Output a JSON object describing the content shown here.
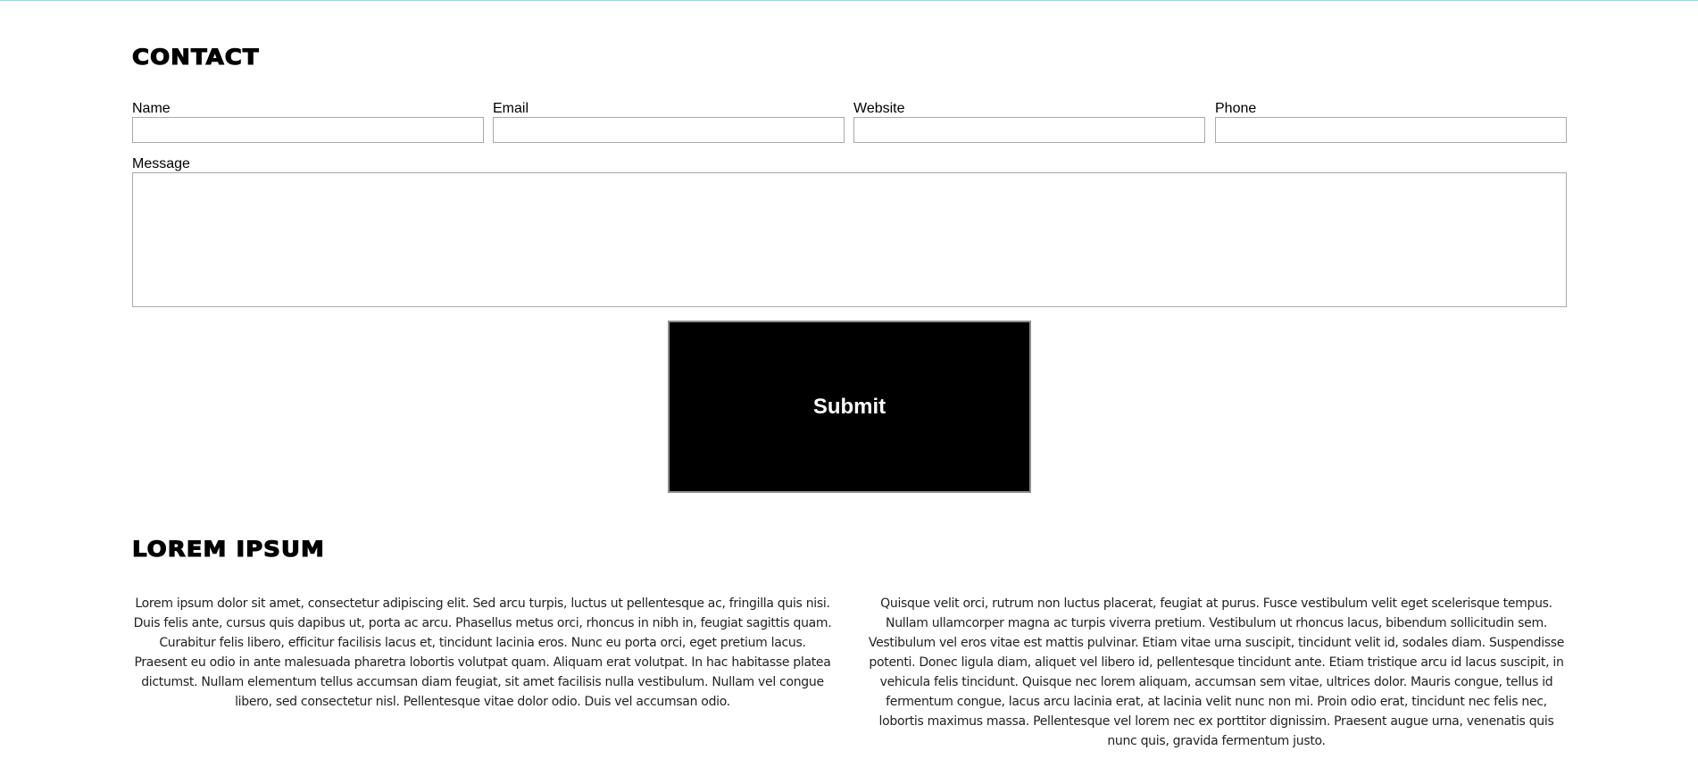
{
  "contact": {
    "title": "Contact",
    "fields": [
      {
        "label": "Name",
        "value": "",
        "placeholder": ""
      },
      {
        "label": "Email",
        "value": "",
        "placeholder": ""
      },
      {
        "label": "Website",
        "value": "",
        "placeholder": ""
      },
      {
        "label": "Phone",
        "value": "",
        "placeholder": ""
      }
    ],
    "message": {
      "label": "Message",
      "value": "",
      "placeholder": ""
    },
    "submit_label": "Submit"
  },
  "lorem": {
    "title": "Lorem Ipsum",
    "paragraphs": [
      "Lorem ipsum dolor sit amet, consectetur adipiscing elit. Sed arcu turpis, luctus ut pellentesque ac, fringilla quis nisi. Duis felis ante, cursus quis dapibus ut, porta ac arcu. Phasellus metus orci, rhoncus in nibh in, feugiat sagittis quam. Curabitur felis libero, efficitur facilisis lacus et, tincidunt lacinia eros. Nunc eu porta orci, eget pretium lacus. Praesent eu odio in ante malesuada pharetra lobortis volutpat quam. Aliquam erat volutpat. In hac habitasse platea dictumst. Nullam elementum tellus accumsan diam feugiat, sit amet facilisis nulla vestibulum. Nullam vel congue libero, sed consectetur nisl. Pellentesque vitae dolor odio. Duis vel accumsan odio.",
      "Quisque velit orci, rutrum non luctus placerat, feugiat at purus. Fusce vestibulum velit eget scelerisque tempus. Nullam ullamcorper magna ac turpis viverra pretium. Vestibulum ut rhoncus lacus, bibendum sollicitudin sem. Vestibulum vel eros vitae est mattis pulvinar. Etiam vitae urna suscipit, tincidunt velit id, sodales diam. Suspendisse potenti. Donec ligula diam, aliquet vel libero id, pellentesque tincidunt ante. Etiam tristique arcu id lacus suscipit, in vehicula felis tincidunt. Quisque nec lorem aliquam, accumsan sem vitae, ultrices dolor. Mauris congue, tellus id fermentum congue, lacus arcu lacinia erat, at lacinia velit nunc non mi. Proin odio erat, tincidunt nec felis nec, lobortis maximus massa. Pellentesque vel lorem nec ex porttitor dignissim. Praesent augue urna, venenatis quis nunc quis, gravida fermentum justo."
    ]
  },
  "colors": {
    "button_background": "#000000",
    "button_text": "#ffffff",
    "field_border": "#a9a9a9",
    "top_rule": "#9fd3e6"
  }
}
